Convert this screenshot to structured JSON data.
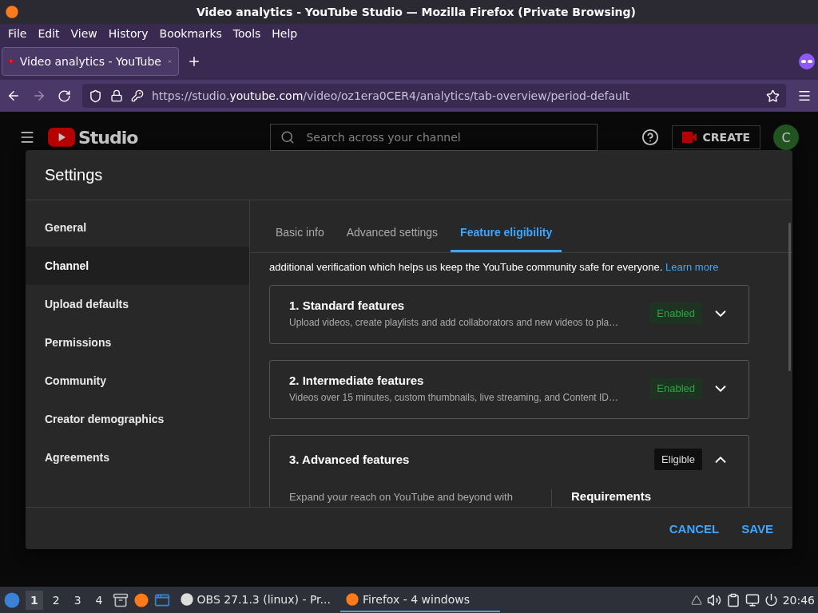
{
  "window": {
    "title": "Video analytics - YouTube Studio — Mozilla Firefox (Private Browsing)"
  },
  "menu": [
    "File",
    "Edit",
    "View",
    "History",
    "Bookmarks",
    "Tools",
    "Help"
  ],
  "browser_tabs": [
    {
      "label": "Video analytics - YouTube",
      "selected": true
    }
  ],
  "address": {
    "prefix": "https://studio.",
    "domain": "youtube.com",
    "path": "/video/oz1era0CER4/analytics/tab-overview/period-default"
  },
  "studio": {
    "logo": "Studio",
    "search_placeholder": "Search across your channel",
    "create": "CREATE",
    "avatar": "C"
  },
  "dialog": {
    "title": "Settings",
    "nav": [
      {
        "label": "General",
        "selected": false
      },
      {
        "label": "Channel",
        "selected": true
      },
      {
        "label": "Upload defaults",
        "selected": false
      },
      {
        "label": "Permissions",
        "selected": false
      },
      {
        "label": "Community",
        "selected": false
      },
      {
        "label": "Creator demographics",
        "selected": false
      },
      {
        "label": "Agreements",
        "selected": false
      }
    ],
    "tabs": [
      {
        "label": "Basic info",
        "selected": false
      },
      {
        "label": "Advanced settings",
        "selected": false
      },
      {
        "label": "Feature eligibility",
        "selected": true
      }
    ],
    "intro": "additional verification which helps us keep the YouTube community safe for everyone.",
    "intro_link": "Learn more",
    "features": [
      {
        "title": "1. Standard features",
        "description": "Upload videos, create playlists and add collaborators and new videos to pla…",
        "status": "Enabled",
        "kind": "enabled",
        "expanded": false
      },
      {
        "title": "2. Intermediate features",
        "description": "Videos over 15 minutes, custom thumbnails, live streaming, and Content ID…",
        "status": "Enabled",
        "kind": "enabled",
        "expanded": false
      },
      {
        "title": "3. Advanced features",
        "description": "Expand your reach on YouTube and beyond with",
        "requirements": "Requirements",
        "status": "Eligible",
        "kind": "eligible",
        "expanded": true
      }
    ],
    "buttons": [
      "CANCEL",
      "SAVE"
    ]
  },
  "taskbar": {
    "workspaces": [
      {
        "label": "1",
        "selected": true
      },
      {
        "label": "2",
        "selected": false
      },
      {
        "label": "3",
        "selected": false
      },
      {
        "label": "4",
        "selected": false
      }
    ],
    "tasks": [
      {
        "label": "OBS 27.1.3 (linux) - Pr...",
        "kind": "obs",
        "selected": false
      },
      {
        "label": "Firefox - 4 windows",
        "kind": "firefox",
        "selected": true
      }
    ],
    "clock": "20:46"
  }
}
